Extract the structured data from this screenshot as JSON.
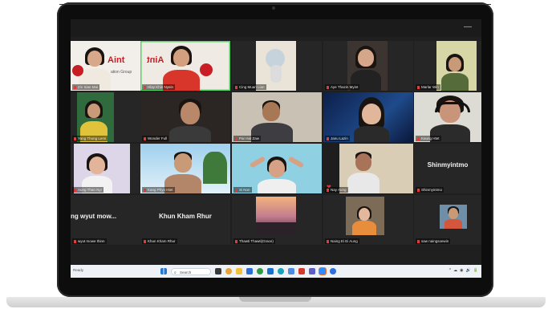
{
  "window": {
    "minimize_glyph": "—"
  },
  "tiles": [
    {
      "name": "Zin Sian Mai",
      "overlay": "Aint",
      "overlay2": "ation Group"
    },
    {
      "name": "Hlay Khin Nyein",
      "overlay": "Aint",
      "highlighted": true
    },
    {
      "name": "Cing Muan Lian"
    },
    {
      "name": "Aye Thazin Myint"
    },
    {
      "name": "Marlar Win"
    },
    {
      "name": "Yang Thong Lemi"
    },
    {
      "name": "Wonder Full"
    },
    {
      "name": "Par Hat Zaw"
    },
    {
      "name": "Janu Lazin"
    },
    {
      "name": "Kaung Htet"
    },
    {
      "name": "Aung Than Nyi"
    },
    {
      "name": "Kang Phyo Htet"
    },
    {
      "name": "Si Non"
    },
    {
      "name": "Nay Aung"
    },
    {
      "name": "Shinmyintmo",
      "display_name": "Shinmyintmo"
    },
    {
      "name": "wyut mowe thinn",
      "display_name": "ng wyut mow..."
    },
    {
      "name": "Khun Kham Rhur",
      "display_name": "Khun Kham Rhur"
    },
    {
      "name": "Thawti Thawti(Grace)"
    },
    {
      "name": "Naing Ei Ei Aung"
    },
    {
      "name": "saw naingsoewin"
    }
  ],
  "taskbar": {
    "left_text": "Ready",
    "search_placeholder": "Search",
    "search_icon": "magnifier-icon",
    "start_icon": "windows-logo-icon",
    "tray": [
      "^",
      "☁",
      "◉",
      "🔊",
      "🔋"
    ]
  },
  "colors": {
    "highlight": "#4cd964",
    "mic_muted": "#e23b3b",
    "laptop": "#0d0d0d"
  }
}
